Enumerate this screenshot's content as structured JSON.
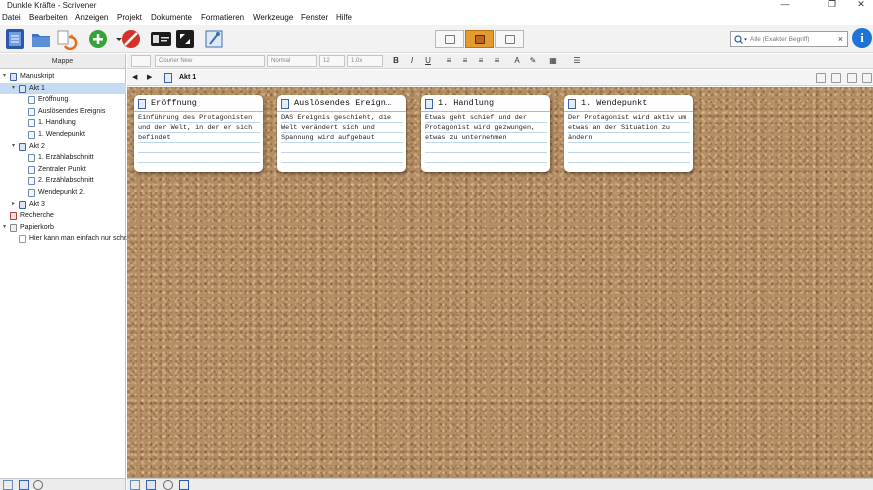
{
  "window": {
    "title": "Dunkle Kräfte - Scrivener",
    "controls": {
      "minimize": "—",
      "maximize": "❐",
      "close": "✕"
    }
  },
  "menubar": [
    "Datei",
    "Bearbeiten",
    "Anzeigen",
    "Projekt",
    "Dokumente",
    "Formatieren",
    "Werkzeuge",
    "Fenster",
    "Hilfe"
  ],
  "toolbar": {
    "icons": [
      "binder-icon",
      "collections-icon",
      "sync-icon",
      "add-icon",
      "delete-icon",
      "quick-reference-icon",
      "fullscreen-icon",
      "inspector-icon"
    ],
    "view_modes": [
      "document",
      "corkboard",
      "outliner"
    ],
    "active_view": "corkboard",
    "search_placeholder": "Alle (Exakter Begriff)",
    "info_label": "i"
  },
  "binder": {
    "header": "Mappe",
    "items": [
      {
        "label": "Manuskript",
        "level": 0,
        "type": "folder",
        "expanded": true
      },
      {
        "label": "Akt 1",
        "level": 1,
        "type": "folder",
        "expanded": true,
        "selected": true
      },
      {
        "label": "Eröffnung",
        "level": 2,
        "type": "doc"
      },
      {
        "label": "Auslösendes Ereignis",
        "level": 2,
        "type": "doc"
      },
      {
        "label": "1. Handlung",
        "level": 2,
        "type": "doc"
      },
      {
        "label": "1. Wendepunkt",
        "level": 2,
        "type": "doc"
      },
      {
        "label": "Akt 2",
        "level": 1,
        "type": "folder",
        "expanded": true
      },
      {
        "label": "1. Erzählabschnitt",
        "level": 2,
        "type": "doc"
      },
      {
        "label": "Zentraler Punkt",
        "level": 2,
        "type": "doc"
      },
      {
        "label": "2. Erzählabschnitt",
        "level": 2,
        "type": "doc"
      },
      {
        "label": "Wendepunkt 2.",
        "level": 2,
        "type": "doc"
      },
      {
        "label": "Akt 3",
        "level": 1,
        "type": "folder",
        "expanded": false
      },
      {
        "label": "Recherche",
        "level": 0,
        "type": "research"
      },
      {
        "label": "Papierkorb",
        "level": 0,
        "type": "trash",
        "expanded": true
      },
      {
        "label": "Hier kann man einfach nur schr...",
        "level": 1,
        "type": "plain"
      }
    ]
  },
  "formatbar": {
    "style": "",
    "font": "Courier New",
    "weight": "Normal",
    "size": "12",
    "spacing": "1.0x",
    "bold": "B",
    "italic": "I",
    "underline": "U"
  },
  "editor": {
    "back": "◀",
    "forward": "▶",
    "document_title": "Akt 1"
  },
  "corkboard": {
    "cards": [
      {
        "title": "Eröffnung",
        "synopsis": "Einführung des Protagonisten und der Welt, in der er sich befindet"
      },
      {
        "title": "Auslösendes Ereign…",
        "synopsis": "DAS Ereignis geschieht, die Welt verändert sich und Spannung wird aufgebaut"
      },
      {
        "title": "1. Handlung",
        "synopsis": "Etwas geht schief und der Protagonist wird gezwungen, etwas zu unternehmen"
      },
      {
        "title": "1. Wendepunkt",
        "synopsis": "Der Protagonist wird aktiv um etwas an der Situation zu ändern"
      }
    ]
  },
  "colors": {
    "accent": "#e39b2f",
    "binder_selection": "#c5dbf3",
    "cork": "#b58e63",
    "card_header_rule": "#e6a3a3",
    "card_lines": "#bfd6ef",
    "info_button": "#1e73d6"
  }
}
